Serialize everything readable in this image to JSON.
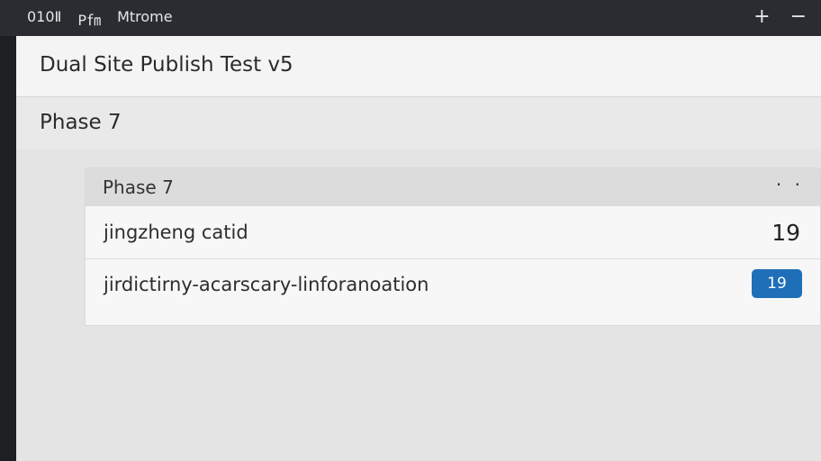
{
  "topbar": {
    "left_items": [
      "010Ⅱ",
      "P㎙",
      "Mtrome"
    ],
    "plus_label": "+",
    "minus_label": "−"
  },
  "app": {
    "title": "Dual Site Publish Test v5"
  },
  "page": {
    "title": "Phase 7"
  },
  "card": {
    "title": "Phase 7",
    "menu_label": "· ·",
    "rows": [
      {
        "label": "jingzheng catid",
        "value": "19"
      },
      {
        "label": "jirdictirny-acarscary-linforanoation",
        "value": "19"
      }
    ]
  },
  "colors": {
    "badge": "#1f6fb8",
    "topbar": "#2a2c31"
  }
}
